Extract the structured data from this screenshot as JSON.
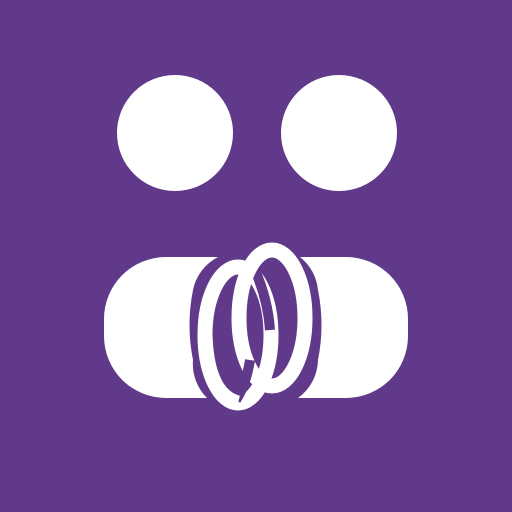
{
  "app_icon": {
    "icon": "two-people-linked-rings-icon",
    "colors": {
      "background": "#61398A",
      "foreground": "#FFFFFF"
    }
  }
}
